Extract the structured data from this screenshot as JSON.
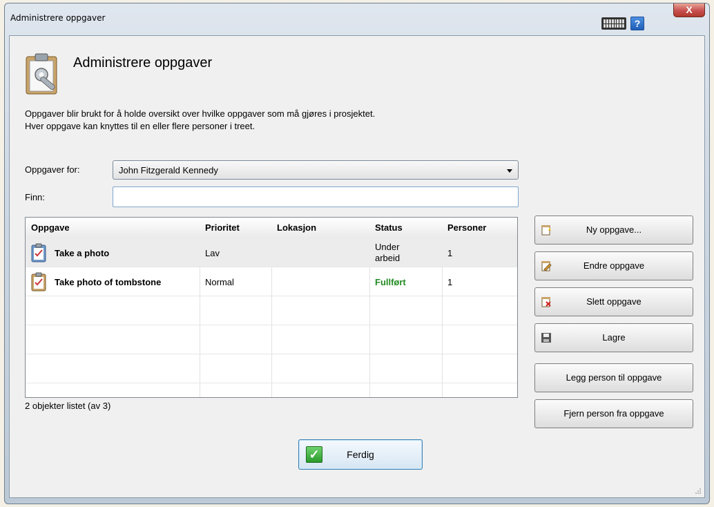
{
  "window": {
    "title": "Administrere oppgaver",
    "close_label": "X",
    "help_label": "?"
  },
  "header": {
    "title": "Administrere oppgaver"
  },
  "description": {
    "line1": "Oppgaver blir brukt for å holde oversikt over hvilke oppgaver som må gjøres i prosjektet.",
    "line2": "Hver oppgave kan knyttes til en eller flere personer i treet."
  },
  "filter": {
    "for_label": "Oppgaver for:",
    "person": "John Fitzgerald Kennedy",
    "find_label": "Finn:",
    "find_value": ""
  },
  "table": {
    "headers": [
      "Oppgave",
      "Prioritet",
      "Lokasjon",
      "Status",
      "Personer"
    ],
    "rows": [
      {
        "task": "Take a photo",
        "priority": "Lav",
        "location": "",
        "status_line1": "Under",
        "status_line2": "arbeid",
        "persons": "1"
      },
      {
        "task": "Take photo of tombstone",
        "priority": "Normal",
        "location": "",
        "status": "Fullført",
        "persons": "1"
      }
    ]
  },
  "count_text": "2 objekter listet (av 3)",
  "buttons": {
    "new_task": "Ny oppgave...",
    "edit_task": "Endre oppgave",
    "delete_task": "Slett oppgave",
    "save": "Lagre",
    "add_person": "Legg person til oppgave",
    "remove_person": "Fjern person fra oppgave",
    "done": "Ferdig"
  },
  "colors": {
    "status_done": "#228b22",
    "accent": "#3c7fb1"
  }
}
